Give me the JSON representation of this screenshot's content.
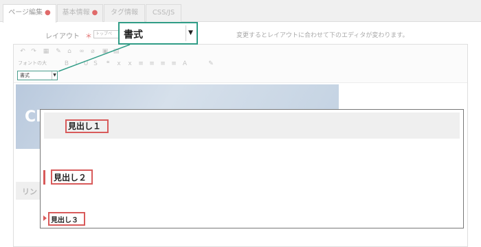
{
  "tabs": [
    {
      "label": "ページ編集",
      "required": "●",
      "active": true
    },
    {
      "label": "基本情報",
      "required": "●",
      "active": false
    },
    {
      "label": "タグ情報",
      "active": false
    },
    {
      "label": "CSS/JS",
      "active": false
    }
  ],
  "layout": {
    "label": "レイアウト",
    "required_mark": "＊",
    "selected": "トップペ",
    "note": "変更するとレイアウトに合わせて下のエディタが変わります。"
  },
  "toolbar": {
    "font_size_label": "フォントの大",
    "format_select_value": "書式",
    "icons": [
      "undo-icon",
      "redo-icon",
      "source-icon",
      "paste-icon",
      "html-icon",
      "link-icon",
      "unlink-icon",
      "image-icon",
      "table-icon",
      "bold-icon",
      "italic-icon",
      "underline-icon",
      "strike-icon",
      "quote-icon",
      "subscript-icon",
      "superscript-icon",
      "align-left-icon",
      "align-center-icon",
      "align-right-icon",
      "justify-icon",
      "text-color-icon",
      "bg-color-icon"
    ]
  },
  "format_callout": {
    "value": "書式",
    "arrow": "▼"
  },
  "content": {
    "banner_text": "Cl",
    "link_text": "リン"
  },
  "format_dropdown": {
    "options": [
      {
        "label": "見出し１"
      },
      {
        "label": "見出し２"
      },
      {
        "label": "見出し３"
      }
    ]
  },
  "colors": {
    "accent_teal": "#2f9c86",
    "heading_red": "#d85a5a"
  }
}
